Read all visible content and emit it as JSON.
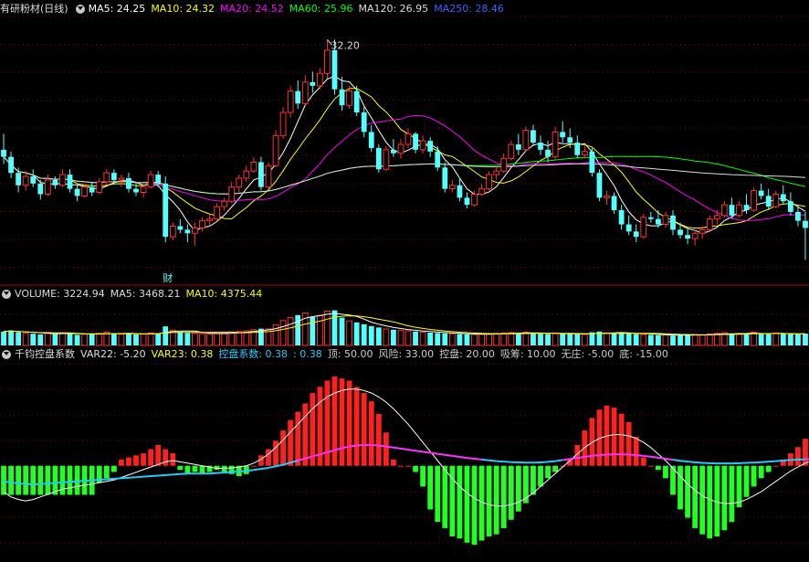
{
  "panel_price": {
    "title": "有研粉材(日线)",
    "ma": [
      {
        "label": "MA5: 24.25",
        "color": "#ffffff"
      },
      {
        "label": "MA10: 24.32",
        "color": "#ffff00"
      },
      {
        "label": "MA20: 24.52",
        "color": "#ff00ff"
      },
      {
        "label": "MA60: 25.96",
        "color": "#00ff00"
      },
      {
        "label": "MA120: 26.95",
        "color": "#dddddd"
      },
      {
        "label": "MA250: 28.46",
        "color": "#3366ff"
      }
    ],
    "high_label": "32.20",
    "event_label": "财"
  },
  "panel_volume": {
    "labels": [
      {
        "label": "VOLUME: 3224.94",
        "color": "#dddddd"
      },
      {
        "label": "MA5: 3468.21",
        "color": "#dddddd"
      },
      {
        "label": "MA10: 4375.44",
        "color": "#ffff00"
      }
    ]
  },
  "panel_indicator": {
    "labels": [
      {
        "label": "千钧控盘系数",
        "color": "#dddddd"
      },
      {
        "label": "VAR22: -5.20",
        "color": "#dddddd"
      },
      {
        "label": "VAR23: 0.38",
        "color": "#ffff00"
      },
      {
        "label": "控盘系数: 0.38",
        "color": "#22ccff"
      },
      {
        "label": ": 0.38",
        "color": "#22ccff"
      },
      {
        "label": "顶: 50.00",
        "color": "#cccccc"
      },
      {
        "label": "风险: 33.00",
        "color": "#cccccc"
      },
      {
        "label": "控盘: 20.00",
        "color": "#cccccc"
      },
      {
        "label": "吸筹: 10.00",
        "color": "#cccccc"
      },
      {
        "label": "无庄: -5.00",
        "color": "#cccccc"
      },
      {
        "label": "底: -15.00",
        "color": "#cccccc"
      }
    ]
  },
  "colors": {
    "up": "#ff3232",
    "down": "#54ffff",
    "grid": "#8b0000",
    "bar_pos": "#ff2020",
    "bar_neg": "#22ff22",
    "ctrl_line": "#22ccff",
    "ctrl_line_hot": "#ff33ff",
    "var_line": "#ffffff"
  },
  "chart_data": [
    {
      "type": "candlestick",
      "title": "有研粉材(日线)",
      "ylim": [
        19,
        33.5
      ],
      "series_overlays": [
        "MA5",
        "MA10",
        "MA20",
        "MA60",
        "MA120"
      ],
      "annotations": [
        {
          "text": "32.20"
        },
        {
          "text": "财"
        }
      ],
      "ohlc": [
        [
          26.0,
          26.9,
          25.2,
          25.6
        ],
        [
          25.6,
          25.9,
          24.4,
          24.7
        ],
        [
          24.7,
          25.0,
          23.6,
          24.0
        ],
        [
          24.0,
          24.8,
          23.7,
          24.5
        ],
        [
          24.5,
          24.9,
          23.9,
          24.1
        ],
        [
          24.1,
          24.3,
          23.2,
          23.5
        ],
        [
          23.5,
          24.6,
          23.4,
          24.3
        ],
        [
          24.3,
          24.5,
          23.8,
          24.0
        ],
        [
          24.0,
          24.9,
          23.9,
          24.6
        ],
        [
          24.6,
          24.9,
          23.6,
          23.8
        ],
        [
          23.8,
          24.0,
          23.1,
          23.4
        ],
        [
          23.4,
          24.1,
          23.3,
          23.9
        ],
        [
          23.9,
          24.2,
          23.4,
          23.6
        ],
        [
          23.6,
          24.4,
          23.5,
          24.2
        ],
        [
          24.2,
          24.9,
          24.0,
          24.7
        ],
        [
          24.7,
          24.9,
          24.1,
          24.3
        ],
        [
          24.3,
          24.6,
          23.9,
          24.4
        ],
        [
          24.4,
          24.7,
          23.6,
          23.8
        ],
        [
          23.8,
          24.2,
          23.4,
          23.6
        ],
        [
          23.6,
          24.0,
          23.3,
          23.9
        ],
        [
          23.9,
          24.8,
          23.8,
          24.6
        ],
        [
          24.6,
          24.8,
          23.9,
          24.1
        ],
        [
          24.1,
          24.5,
          20.8,
          21.1
        ],
        [
          21.1,
          21.9,
          20.9,
          21.7
        ],
        [
          21.7,
          22.1,
          21.3,
          21.5
        ],
        [
          21.5,
          21.8,
          20.8,
          21.3
        ],
        [
          21.3,
          21.9,
          20.6,
          21.6
        ],
        [
          21.6,
          22.2,
          21.4,
          22.0
        ],
        [
          22.0,
          22.4,
          21.7,
          22.1
        ],
        [
          22.1,
          23.0,
          22.0,
          22.8
        ],
        [
          22.8,
          23.3,
          22.6,
          23.1
        ],
        [
          23.1,
          24.2,
          23.0,
          23.9
        ],
        [
          23.9,
          24.6,
          23.6,
          24.4
        ],
        [
          24.4,
          25.1,
          24.2,
          24.8
        ],
        [
          24.8,
          25.6,
          24.7,
          25.3
        ],
        [
          25.3,
          25.6,
          23.7,
          23.9
        ],
        [
          23.9,
          25.3,
          23.8,
          25.1
        ],
        [
          25.1,
          27.1,
          25.0,
          26.8
        ],
        [
          26.8,
          28.4,
          26.6,
          28.1
        ],
        [
          28.1,
          29.6,
          27.8,
          29.3
        ],
        [
          29.3,
          29.9,
          28.3,
          28.6
        ],
        [
          28.6,
          30.2,
          28.5,
          29.8
        ],
        [
          29.8,
          30.4,
          29.2,
          29.6
        ],
        [
          29.6,
          30.6,
          29.4,
          30.3
        ],
        [
          30.3,
          32.2,
          30.0,
          31.6
        ],
        [
          31.6,
          32.2,
          29.1,
          29.4
        ],
        [
          29.4,
          30.1,
          28.2,
          28.5
        ],
        [
          28.5,
          29.6,
          28.3,
          29.3
        ],
        [
          29.3,
          29.6,
          27.9,
          28.1
        ],
        [
          28.1,
          28.4,
          26.7,
          27.0
        ],
        [
          27.0,
          27.4,
          25.9,
          26.1
        ],
        [
          26.1,
          26.3,
          24.7,
          24.9
        ],
        [
          24.9,
          26.2,
          24.8,
          26.0
        ],
        [
          26.0,
          26.6,
          25.6,
          25.8
        ],
        [
          25.8,
          26.6,
          25.5,
          26.3
        ],
        [
          26.3,
          27.2,
          26.1,
          26.9
        ],
        [
          26.9,
          27.0,
          25.8,
          26.0
        ],
        [
          26.0,
          26.8,
          25.8,
          26.5
        ],
        [
          26.5,
          26.7,
          25.6,
          25.9
        ],
        [
          25.9,
          26.2,
          24.8,
          25.0
        ],
        [
          25.0,
          25.3,
          23.6,
          23.8
        ],
        [
          23.8,
          24.3,
          23.6,
          24.0
        ],
        [
          24.0,
          24.4,
          23.1,
          23.3
        ],
        [
          23.3,
          23.6,
          22.7,
          22.9
        ],
        [
          22.9,
          23.7,
          22.8,
          23.5
        ],
        [
          23.5,
          24.1,
          23.4,
          23.8
        ],
        [
          23.8,
          24.8,
          23.7,
          24.6
        ],
        [
          24.6,
          25.1,
          24.3,
          24.8
        ],
        [
          24.8,
          25.8,
          24.7,
          25.5
        ],
        [
          25.5,
          26.5,
          25.4,
          26.3
        ],
        [
          26.3,
          26.9,
          25.7,
          26.0
        ],
        [
          26.0,
          27.3,
          25.9,
          27.1
        ],
        [
          27.1,
          27.4,
          26.2,
          26.4
        ],
        [
          26.4,
          26.8,
          25.7,
          26.0
        ],
        [
          26.0,
          26.5,
          25.3,
          25.6
        ],
        [
          25.6,
          27.3,
          25.4,
          27.0
        ],
        [
          27.0,
          27.6,
          26.4,
          26.7
        ],
        [
          26.7,
          27.2,
          26.1,
          26.4
        ],
        [
          26.4,
          26.8,
          25.5,
          25.7
        ],
        [
          25.7,
          26.3,
          25.5,
          25.9
        ],
        [
          25.9,
          26.1,
          24.5,
          24.7
        ],
        [
          24.7,
          24.9,
          23.1,
          23.3
        ],
        [
          23.3,
          23.7,
          22.9,
          23.4
        ],
        [
          23.4,
          23.6,
          22.4,
          22.6
        ],
        [
          22.6,
          22.9,
          21.5,
          21.8
        ],
        [
          21.8,
          22.3,
          21.2,
          21.4
        ],
        [
          21.4,
          21.8,
          20.8,
          21.1
        ],
        [
          21.1,
          22.4,
          21.0,
          22.2
        ],
        [
          22.2,
          22.5,
          21.9,
          22.1
        ],
        [
          22.1,
          22.6,
          21.6,
          21.8
        ],
        [
          21.8,
          22.5,
          21.6,
          22.3
        ],
        [
          22.3,
          22.6,
          21.2,
          21.5
        ],
        [
          21.5,
          21.9,
          21.0,
          21.2
        ],
        [
          21.2,
          21.6,
          20.7,
          21.0
        ],
        [
          21.0,
          21.5,
          20.6,
          21.3
        ],
        [
          21.3,
          21.7,
          21.0,
          21.5
        ],
        [
          21.5,
          22.3,
          21.4,
          22.1
        ],
        [
          22.1,
          22.6,
          21.8,
          22.3
        ],
        [
          22.3,
          23.1,
          22.2,
          22.9
        ],
        [
          22.9,
          23.3,
          22.1,
          22.3
        ],
        [
          22.3,
          23.1,
          22.2,
          22.9
        ],
        [
          22.9,
          23.5,
          22.4,
          22.6
        ],
        [
          22.6,
          23.9,
          22.5,
          23.7
        ],
        [
          23.7,
          24.1,
          23.2,
          23.4
        ],
        [
          23.4,
          23.8,
          22.6,
          22.8
        ],
        [
          22.8,
          23.7,
          22.7,
          23.5
        ],
        [
          23.5,
          24.0,
          22.9,
          23.1
        ],
        [
          23.1,
          23.6,
          22.3,
          22.5
        ],
        [
          22.5,
          22.9,
          21.7,
          22.0
        ],
        [
          22.0,
          22.5,
          19.8,
          21.6
        ]
      ]
    },
    {
      "type": "bar",
      "title": "VOLUME",
      "ylim": [
        0,
        12000
      ],
      "series_overlays": [
        "MA5",
        "MA10"
      ],
      "values": [
        3800,
        4100,
        3600,
        3300,
        3200,
        3000,
        3500,
        3100,
        3400,
        3200,
        2900,
        3100,
        3000,
        3300,
        3600,
        3200,
        3100,
        3300,
        3000,
        3100,
        3400,
        3200,
        5200,
        4200,
        3700,
        3400,
        3300,
        3200,
        3100,
        3300,
        3400,
        3600,
        3800,
        4000,
        4300,
        4600,
        4500,
        5600,
        6800,
        7600,
        8300,
        8900,
        7800,
        8200,
        9400,
        9600,
        7600,
        6700,
        6300,
        5800,
        5300,
        4900,
        4500,
        4300,
        4100,
        4000,
        3800,
        3600,
        3500,
        3400,
        3300,
        3200,
        3100,
        3000,
        3000,
        3100,
        3200,
        3300,
        3400,
        3500,
        3300,
        3600,
        3400,
        3200,
        3100,
        3300,
        3200,
        3100,
        3000,
        3000,
        3600,
        3800,
        3400,
        3300,
        3500,
        3300,
        3100,
        3000,
        2900,
        2800,
        2900,
        2700,
        2800,
        2900,
        3000,
        2900,
        3100,
        3300,
        3500,
        3200,
        3100,
        3300,
        3600,
        3200,
        3100,
        3300,
        3200,
        3100,
        3000,
        3224.94
      ]
    },
    {
      "type": "bar",
      "title": "千钧控盘系数",
      "ylim": [
        -36,
        40
      ],
      "series_overlays": [
        "VAR22 (white line)",
        "控盘系数 (cyan/magenta line)"
      ],
      "values": [
        -11.2,
        -11.2,
        -11.2,
        -11.2,
        -11.2,
        -11.2,
        -11.2,
        -11.2,
        -11.2,
        -11.2,
        -11.2,
        -11.2,
        -11.2,
        -6.4,
        -4.8,
        -2.4,
        2.4,
        3.2,
        4.0,
        4.8,
        6.4,
        8.0,
        6.4,
        4.8,
        -1.6,
        -3.2,
        -2.4,
        -3.2,
        -2.4,
        -1.6,
        -2.4,
        -3.2,
        -4.0,
        -3.2,
        0,
        4.0,
        6.4,
        9.6,
        13.6,
        17.6,
        20.8,
        24.0,
        28.0,
        30.4,
        32.8,
        34.4,
        33.6,
        32.8,
        30.4,
        28.0,
        24.8,
        20.0,
        12.8,
        2.4,
        0,
        0,
        -2.4,
        -8.0,
        -16.8,
        -21.6,
        -24.0,
        -27.2,
        -28.0,
        -29.6,
        -30.4,
        -28.8,
        -27.2,
        -26.4,
        -24.0,
        -20.8,
        -17.6,
        -14.4,
        -11.2,
        -8.0,
        -4.8,
        -2.4,
        0,
        2.4,
        8.0,
        13.6,
        18.4,
        21.6,
        23.2,
        22.4,
        20.0,
        16.8,
        11.2,
        3.2,
        0,
        -1.6,
        -4.8,
        -11.2,
        -16.8,
        -20.0,
        -24.0,
        -26.4,
        -28.0,
        -27.2,
        -24.8,
        -21.6,
        -16.0,
        -12.0,
        -8.0,
        -4.8,
        -2.4,
        0,
        2.4,
        4.8,
        7.2,
        10.4,
        13.6,
        15.2,
        16.8,
        16.0,
        14.4,
        12.0,
        9.6,
        6.4,
        4.0,
        2.4
      ],
      "control_coefficient": [
        -6.0,
        -6.4,
        -6.8,
        -7.0,
        -7.2,
        -7.0,
        -6.8,
        -6.6,
        -6.4,
        -6.2,
        -6.0,
        -5.8,
        -5.6,
        -5.4,
        -5.2,
        -5.0,
        -4.8,
        -4.6,
        -4.4,
        -4.2,
        -4.0,
        -3.8,
        -3.6,
        -3.4,
        -3.2,
        -3.0,
        -3.0,
        -3.0,
        -3.0,
        -2.8,
        -2.6,
        -2.4,
        -2.2,
        -2.0,
        -1.6,
        -1.2,
        -0.8,
        -0.2,
        0.4,
        1.2,
        2.0,
        2.8,
        3.6,
        4.4,
        5.2,
        6.0,
        6.8,
        7.4,
        7.8,
        8.0,
        8.0,
        7.8,
        7.4,
        7.0,
        6.6,
        6.2,
        5.8,
        5.4,
        5.0,
        4.6,
        4.2,
        3.8,
        3.4,
        3.0,
        2.7,
        2.4,
        2.1,
        1.8,
        1.6,
        1.4,
        1.3,
        1.2,
        1.2,
        1.3,
        1.5,
        1.8,
        2.2,
        2.6,
        3.0,
        3.4,
        3.8,
        4.1,
        4.3,
        4.4,
        4.4,
        4.3,
        4.1,
        3.8,
        3.5,
        3.1,
        2.7,
        2.3,
        1.9,
        1.6,
        1.3,
        1.1,
        1.0,
        0.9,
        0.9,
        0.9,
        1.0,
        1.1,
        1.2,
        1.4,
        1.6,
        1.8,
        2.0,
        2.2,
        2.4,
        2.5,
        2.6,
        2.6,
        2.5,
        2.4,
        2.2,
        2.0,
        1.8,
        1.6,
        1.4,
        0.38
      ],
      "var22": [
        -10.0,
        -12.0,
        -13.0,
        -13.5,
        -13.0,
        -12.0,
        -11.0,
        -10.0,
        -9.0,
        -8.5,
        -8.0,
        -7.5,
        -7.0,
        -6.5,
        -6.0,
        -5.5,
        -4.5,
        -3.5,
        -2.5,
        -1.5,
        -0.5,
        0.5,
        1.5,
        2.0,
        1.5,
        1.0,
        0.5,
        0.0,
        -0.5,
        -1.0,
        -1.0,
        -0.8,
        -0.5,
        0.0,
        1.0,
        2.5,
        4.5,
        7.0,
        10.0,
        13.0,
        16.0,
        19.0,
        22.0,
        24.5,
        26.5,
        28.0,
        29.0,
        29.5,
        29.5,
        29.0,
        28.0,
        26.5,
        24.5,
        22.0,
        19.0,
        16.0,
        12.5,
        9.0,
        5.5,
        2.0,
        -1.5,
        -5.0,
        -8.0,
        -10.5,
        -12.5,
        -14.0,
        -15.0,
        -15.5,
        -15.5,
        -15.0,
        -14.0,
        -12.5,
        -10.5,
        -8.0,
        -5.5,
        -3.0,
        -0.5,
        2.0,
        4.5,
        7.0,
        9.0,
        10.5,
        11.5,
        12.0,
        12.0,
        11.5,
        10.5,
        9.0,
        7.0,
        4.5,
        2.0,
        -1.0,
        -4.0,
        -7.0,
        -9.5,
        -11.5,
        -13.0,
        -14.0,
        -14.5,
        -14.5,
        -14.0,
        -13.0,
        -11.5,
        -10.0,
        -8.0,
        -6.0,
        -4.0,
        -2.0,
        -0.5,
        1.0,
        2.0,
        3.0,
        3.5,
        3.5,
        3.0,
        2.0,
        0.5,
        -1.0,
        -3.0,
        -5.2
      ]
    }
  ]
}
